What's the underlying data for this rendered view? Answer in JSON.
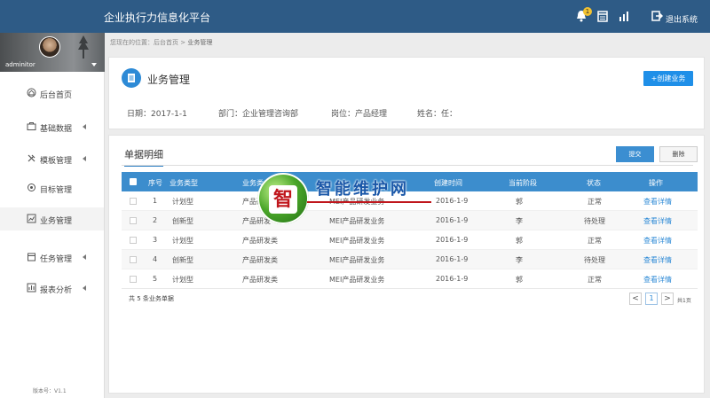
{
  "app": {
    "title": "企业执行力信息化平台",
    "notification_count": "1",
    "logout_label": "退出系统"
  },
  "user": {
    "name": "adminitor"
  },
  "sidebar": {
    "items": [
      {
        "label": "后台首页",
        "icon": "home-icon",
        "arrow": false,
        "active": false
      },
      {
        "label": "基础数据",
        "icon": "briefcase-icon",
        "arrow": true,
        "active": false
      },
      {
        "label": "模板管理",
        "icon": "tools-icon",
        "arrow": true,
        "active": false
      },
      {
        "label": "目标管理",
        "icon": "target-icon",
        "arrow": false,
        "active": false
      },
      {
        "label": "业务管理",
        "icon": "chart-icon",
        "arrow": false,
        "active": true
      },
      {
        "label": "任务管理",
        "icon": "calendar-icon",
        "arrow": true,
        "active": false
      },
      {
        "label": "报表分析",
        "icon": "pie-icon",
        "arrow": true,
        "active": false
      }
    ],
    "version": "版本号：V1.1"
  },
  "breadcrumb": {
    "prefix": "您现在的位置：后台首页",
    "separator": ">",
    "current": "业务管理"
  },
  "header": {
    "title": "业务管理",
    "create_label": "+创建业务",
    "date": "日期：2017-1-1",
    "department": "部门：企业管理咨询部",
    "position": "岗位：产品经理",
    "name": "姓名：任："
  },
  "list": {
    "title": "单据明细",
    "submit_label": "提交",
    "delete_label": "删除",
    "columns": [
      "序号",
      "业务类型",
      "业务类",
      "",
      "创建时间",
      "当前阶段",
      "状态",
      "操作"
    ],
    "rows": [
      {
        "no": "1",
        "type": "计划型",
        "category": "产品研发",
        "name": "MEI产品研发业务",
        "created": "2016-1-9",
        "stage": "郭",
        "status": "正常",
        "action": "查看详情"
      },
      {
        "no": "2",
        "type": "创新型",
        "category": "产品研发",
        "name": "MEI产品研发业务",
        "created": "2016-1-9",
        "stage": "李",
        "status": "待处理",
        "action": "查看详情"
      },
      {
        "no": "3",
        "type": "计划型",
        "category": "产品研发类",
        "name": "MEI产品研发业务",
        "created": "2016-1-9",
        "stage": "郭",
        "status": "正常",
        "action": "查看详情"
      },
      {
        "no": "4",
        "type": "创新型",
        "category": "产品研发类",
        "name": "MEI产品研发业务",
        "created": "2016-1-9",
        "stage": "李",
        "status": "待处理",
        "action": "查看详情"
      },
      {
        "no": "5",
        "type": "计划型",
        "category": "产品研发类",
        "name": "MEI产品研发业务",
        "created": "2016-1-9",
        "stage": "郭",
        "status": "正常",
        "action": "查看详情"
      }
    ],
    "count_text": "共 5 条业务单据",
    "pagination": {
      "prev": "<",
      "current": "1",
      "next": ">",
      "total": "共1页"
    }
  },
  "watermark": {
    "char": "智",
    "text": "智能维护网"
  }
}
